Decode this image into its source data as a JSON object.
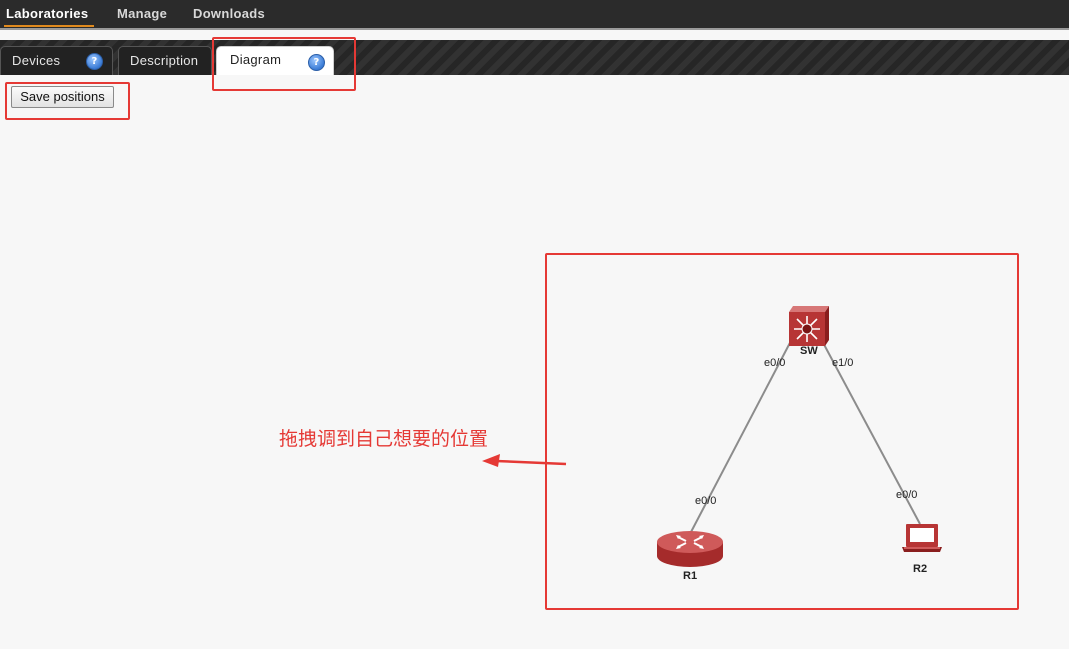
{
  "topnav": {
    "items": [
      {
        "label": "Laboratories"
      },
      {
        "label": "Manage"
      },
      {
        "label": "Downloads"
      }
    ]
  },
  "tabs": [
    {
      "label": "Devices",
      "help": "?"
    },
    {
      "label": "Description"
    },
    {
      "label": "Diagram",
      "help": "?"
    }
  ],
  "toolbar": {
    "save_label": "Save positions"
  },
  "diagram": {
    "nodes": [
      {
        "name": "SW",
        "icon": "switch-icon"
      },
      {
        "name": "R1",
        "icon": "router-icon"
      },
      {
        "name": "R2",
        "icon": "laptop-icon"
      }
    ],
    "links": [
      {
        "a": "SW",
        "a_if": "e0/0",
        "b": "R1",
        "b_if": "e0/0"
      },
      {
        "a": "SW",
        "a_if": "e1/0",
        "b": "R2",
        "b_if": "e0/0"
      }
    ]
  },
  "annotation": {
    "text": "拖拽调到自己想要的位置",
    "color": "#e53935"
  }
}
